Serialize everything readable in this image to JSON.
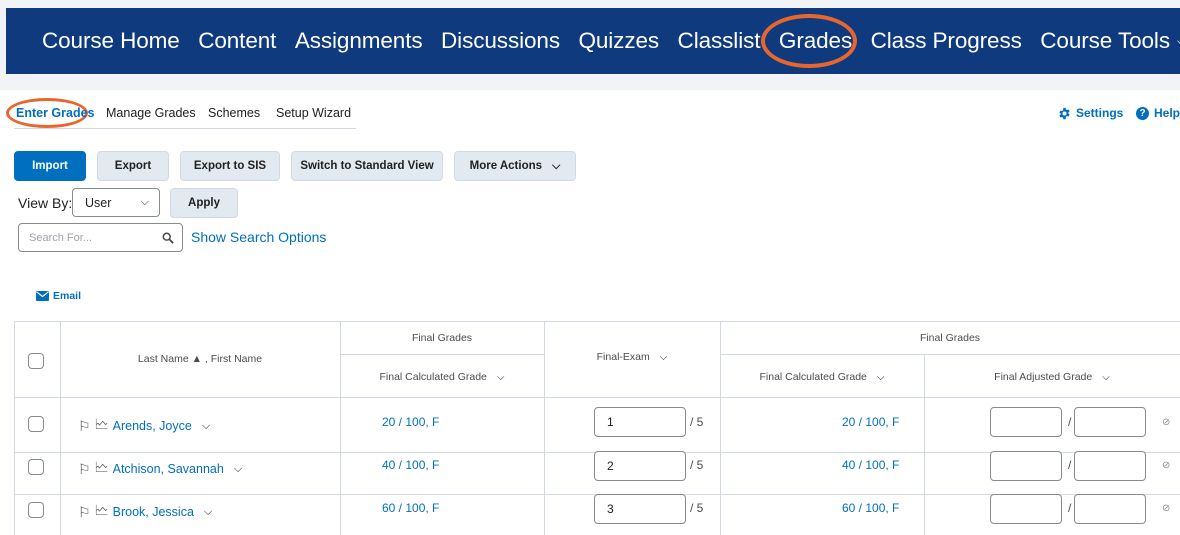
{
  "nav": {
    "items": [
      "Course Home",
      "Content",
      "Assignments",
      "Discussions",
      "Quizzes",
      "Classlist",
      "Grades",
      "Class Progress",
      "Course Tools"
    ],
    "tools_chevron": "chevron-down-icon"
  },
  "subtabs": {
    "items": [
      "Enter Grades",
      "Manage Grades",
      "Schemes",
      "Setup Wizard"
    ],
    "active": "Enter Grades"
  },
  "top_right": {
    "settings": "Settings",
    "help": "Help"
  },
  "toolbar": {
    "import": "Import",
    "export": "Export",
    "export_sis": "Export to SIS",
    "switch_view": "Switch to Standard View",
    "more_actions": "More Actions"
  },
  "view_by": {
    "label": "View By:",
    "selected": "User",
    "apply": "Apply"
  },
  "search": {
    "placeholder": "Search For...",
    "options_link": "Show Search Options"
  },
  "email": "Email",
  "table": {
    "name_header": "Last Name ▲ , First Name",
    "group1": {
      "title": "Final Grades",
      "col": "Final Calculated Grade"
    },
    "exam_header": "Final-Exam",
    "group2": {
      "title": "Final Grades",
      "col_calc": "Final Calculated Grade",
      "col_adj": "Final Adjusted Grade"
    },
    "rows": [
      {
        "name": "Arends, Joyce",
        "calc": "20 / 100, F",
        "exam": "1",
        "out_of": "/ 5",
        "calc2": "20 / 100, F"
      },
      {
        "name": "Atchison, Savannah",
        "calc": "40 / 100, F",
        "exam": "2",
        "out_of": "/ 5",
        "calc2": "40 / 100, F"
      },
      {
        "name": "Brook, Jessica",
        "calc": "60 / 100, F",
        "exam": "3",
        "out_of": "/ 5",
        "calc2": "60 / 100, F"
      }
    ]
  },
  "colors": {
    "nav_bg": "#0f3a7d",
    "accent": "#006fbf",
    "highlight": "#e8662c"
  }
}
